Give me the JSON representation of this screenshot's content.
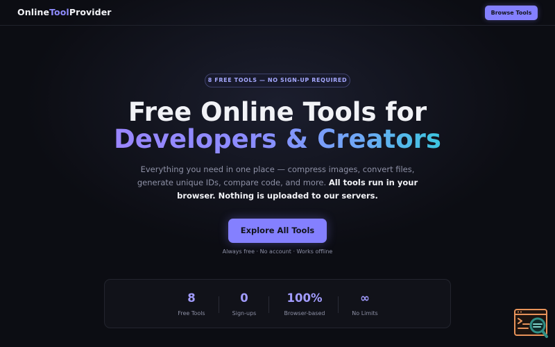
{
  "header": {
    "logo_part1": "Online",
    "logo_part2": "Tool",
    "logo_part3": "Provider",
    "browse_button": "Browse Tools"
  },
  "hero": {
    "badge": "8 FREE TOOLS — NO SIGN-UP REQUIRED",
    "title_line1": "Free Online Tools for",
    "title_line2": "Developers & Creators",
    "subtitle_plain": "Everything you need in one place — compress images, convert files, generate unique IDs, compare code, and more. ",
    "subtitle_strong": "All tools run in your browser. Nothing is uploaded to our servers.",
    "cta_button": "Explore All Tools",
    "cta_note": "Always free · No account · Works offline"
  },
  "stats": [
    {
      "value": "8",
      "label": "Free Tools"
    },
    {
      "value": "0",
      "label": "Sign-ups"
    },
    {
      "value": "100%",
      "label": "Browser-based"
    },
    {
      "value": "∞",
      "label": "No Limits"
    }
  ],
  "corner_widget": {
    "icon": "terminal-search-icon"
  },
  "colors": {
    "background": "#0c0d13",
    "accent": "#8480ff",
    "accent_text": "#a29cff",
    "gradient_start": "#9a86ff",
    "gradient_end": "#3cc6df",
    "muted_text": "#8e91a6",
    "widget_orange": "#e8935a",
    "widget_teal": "#2f8f86"
  }
}
